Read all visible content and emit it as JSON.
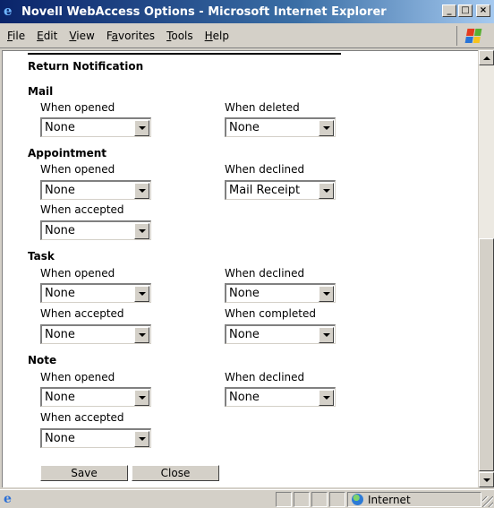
{
  "window": {
    "title": "Novell WebAccess Options - Microsoft Internet Explorer",
    "min_glyph": "_",
    "max_glyph": "□",
    "close_glyph": "×"
  },
  "menu": [
    {
      "label": "File",
      "accel": "F",
      "rest": "ile"
    },
    {
      "label": "Edit",
      "accel": "E",
      "rest": "dit"
    },
    {
      "label": "View",
      "accel": "V",
      "rest": "iew"
    },
    {
      "label": "Favorites",
      "pre": "F",
      "accel": "a",
      "rest": "vorites"
    },
    {
      "label": "Tools",
      "accel": "T",
      "rest": "ools"
    },
    {
      "label": "Help",
      "accel": "H",
      "rest": "elp"
    }
  ],
  "section_title": "Return Notification",
  "mail": {
    "heading": "Mail",
    "opened_label": "When opened",
    "opened_value": "None",
    "deleted_label": "When deleted",
    "deleted_value": "None"
  },
  "appointment": {
    "heading": "Appointment",
    "opened_label": "When opened",
    "opened_value": "None",
    "declined_label": "When declined",
    "declined_value": "Mail Receipt",
    "accepted_label": "When accepted",
    "accepted_value": "None"
  },
  "task": {
    "heading": "Task",
    "opened_label": "When opened",
    "opened_value": "None",
    "declined_label": "When declined",
    "declined_value": "None",
    "accepted_label": "When accepted",
    "accepted_value": "None",
    "completed_label": "When completed",
    "completed_value": "None"
  },
  "note": {
    "heading": "Note",
    "opened_label": "When opened",
    "opened_value": "None",
    "declined_label": "When declined",
    "declined_value": "None",
    "accepted_label": "When accepted",
    "accepted_value": "None"
  },
  "buttons": {
    "save": "Save",
    "close": "Close"
  },
  "status": {
    "zone": "Internet"
  }
}
